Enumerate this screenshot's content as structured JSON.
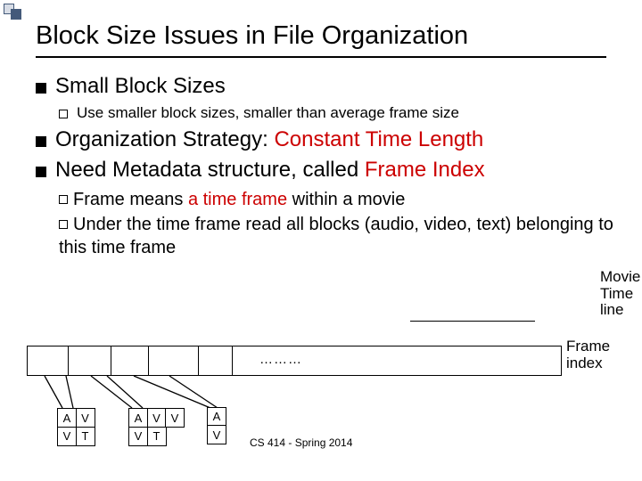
{
  "title": "Block Size Issues in File Organization",
  "bullets": {
    "small_block_sizes": "Small Block Sizes",
    "use_smaller": "Use smaller block sizes, smaller than average frame size",
    "org_strategy_prefix": "Organization Strategy: ",
    "org_strategy_red": "Constant Time Length",
    "need_metadata_prefix": "Need Metadata structure, called ",
    "need_metadata_red": "Frame Index",
    "frame_means_prefix": "Frame means ",
    "frame_means_red": "a time frame ",
    "frame_means_suffix": "within a movie",
    "under_frame": "Under the time frame read all blocks (audio, video, text) belonging to this time frame"
  },
  "labels": {
    "movie_timeline": "Movie Time line",
    "frame_index": "Frame index",
    "ellipsis": "………"
  },
  "blocks": {
    "set1": [
      "A",
      "V",
      "V",
      "T"
    ],
    "set2": [
      "A",
      "V",
      "V",
      "V",
      "T"
    ],
    "set3": [
      "A",
      "V"
    ]
  },
  "footer": "CS 414 - Spring 2014"
}
